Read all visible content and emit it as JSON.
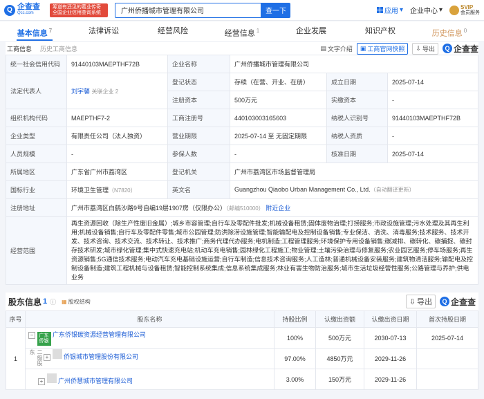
{
  "header": {
    "logo_text": "企查查",
    "logo_sub": "Qcc.com",
    "slogan": "筹道有还见的葛业传奇 全国企业信用查询系统",
    "search_value": "广州侨播城市管理有限公司",
    "search_btn": "查一下",
    "app": "应用",
    "center": "企业中心",
    "svip": "SVIP",
    "svip_sub": "会员服务"
  },
  "tabs": [
    {
      "label": "基本信息",
      "count": "7"
    },
    {
      "label": "法律诉讼",
      "count": ""
    },
    {
      "label": "经营风险",
      "count": ""
    },
    {
      "label": "经营信息",
      "count": "1"
    },
    {
      "label": "企业发展",
      "count": ""
    },
    {
      "label": "知识产权",
      "count": ""
    },
    {
      "label": "历史信息",
      "count": "0"
    }
  ],
  "subbar": {
    "tab1": "工商信息",
    "tab2": "历史工商信息",
    "tool1": "文字介绍",
    "tool2": "工商官网快照",
    "tool3": "导出",
    "watermark": "企查查"
  },
  "info": {
    "r1": {
      "k1": "统一社会信用代码",
      "v1": "91440103MAEPTHF72B",
      "k2": "企业名称",
      "v2": "广州侨播城市管理有限公司"
    },
    "r2": {
      "k1": "法定代表人",
      "v1": "刘宇馨",
      "v1b": "关联企业 2",
      "k2": "登记状态",
      "v2": "存续（在营、开业、在册）",
      "k3": "成立日期",
      "v3": "2025-07-14"
    },
    "r3": {
      "k2": "注册资本",
      "v2": "500万元",
      "k3": "实缴资本",
      "v3": "-"
    },
    "r4": {
      "k1": "组织机构代码",
      "v1": "MAEPTHF7-2",
      "k2": "工商注册号",
      "v2": "440103003165603",
      "k3": "纳税人识别号",
      "v3": "91440103MAEPTHF72B"
    },
    "r5": {
      "k1": "企业类型",
      "v1": "有限责任公司（法人独资）",
      "k2": "营业期限",
      "v2": "2025-07-14 至 无固定期限",
      "k3": "纳税人资质",
      "v3": "-"
    },
    "r6": {
      "k1": "人员规模",
      "v1": "-",
      "k2": "参保人数",
      "v2": "-",
      "k3": "核准日期",
      "v3": "2025-07-14"
    },
    "r7": {
      "k1": "所属地区",
      "v1": "广东省广州市荔湾区",
      "k2": "登记机关",
      "v2": "广州市荔湾区市场监督管理局"
    },
    "r8": {
      "k1": "国标行业",
      "v1": "环境卫生管理",
      "v1b": "（N7820）",
      "k2": "英文名",
      "v2": "Guangzhou Qiaobo Urban Management Co., Ltd.",
      "v2b": "（自动翻译更新）"
    },
    "r9": {
      "k1": "注册地址",
      "v1": "广州市荔湾区白鹤沙路9号自编19层1907房（仅限办公）",
      "v1b": "（邮编510000）",
      "v1c": "附近企业"
    },
    "r10": {
      "k1": "经营范围",
      "v1": "再生资源回收（除生产性废旧金属）;城乡市容管理;自行车及零配件批发;机械设备租赁;固体废物治理;打捞服务;市政设施管理;污水处理及其再生利用;机械设备销售;自行车及零配件零售;城市公园管理;防洪除涝设施管理;智能输配电及控制设备销售;专业保洁、清洗、消毒服务;技术服务、技术开发、技术咨询、技术交流、技术转让、技术推广;商务代理代办服务;电机制造;工程管理服务;环境保护专用设备销售;碳减排、碳转化、碳捕捉、碳封存技术研发;城市绿化管理;集中式快速充电站;机动车充电销售;园林绿化工程施工;物业管理;土壤污染治理与修复服务;农业园艺服务;停车场服务;再生资源销售;5G通信技术服务;电动汽车充电基础设施运营;自行车制造;信息技术咨询服务;人工造林;普通机械设备安装服务;建筑物清洁服务;输配电及控制设备制造;建筑工程机械与设备租赁;智能控制系统集成;信息系统集成服务;林业有害生物防治服务;城市生活垃圾经营性服务;公路管理与养护;供电业务"
    }
  },
  "shareholders": {
    "title": "股东信息",
    "count": "1",
    "link": "股权结构",
    "export": "导出",
    "watermark": "企查查",
    "headers": [
      "序号",
      "股东名称",
      "持股比例",
      "认缴出资额",
      "认缴出资日期",
      "首次持股日期"
    ],
    "rows": [
      {
        "no": "1",
        "name": "广东侨银碳资源经营管理有限公司",
        "logo": "广东侨银",
        "pct": "100%",
        "amt": "500万元",
        "date": "2030-07-13",
        "first": "2025-07-14"
      }
    ],
    "sub_level": "二级股东",
    "sub": [
      {
        "name": "侨银城市管理股份有限公司",
        "pct": "97.00%",
        "amt": "4850万元",
        "date": "2029-11-26"
      },
      {
        "name": "广州侨慧城市管理有限公司",
        "pct": "3.00%",
        "amt": "150万元",
        "date": "2029-11-26"
      }
    ]
  }
}
